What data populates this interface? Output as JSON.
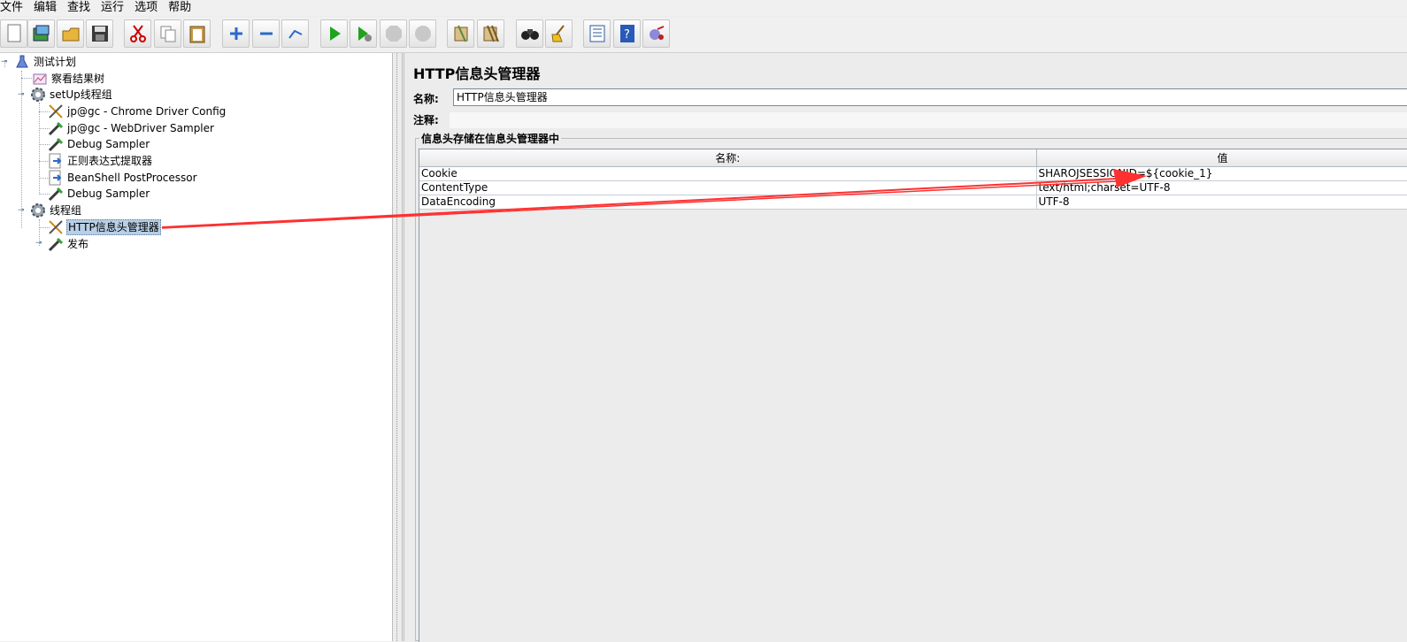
{
  "menu": [
    "文件",
    "编辑",
    "查找",
    "运行",
    "选项",
    "帮助"
  ],
  "toolbar": {
    "icons": [
      "new-icon",
      "templates-icon",
      "open-icon",
      "save-icon",
      "cut-icon",
      "copy-icon",
      "paste-icon",
      "expand-icon",
      "collapse-icon",
      "toggle-icon",
      "start-icon",
      "start-no-pause-icon",
      "stop-icon",
      "shutdown-icon",
      "clear-icon",
      "clear-all-icon",
      "search-icon",
      "reset-search-icon",
      "function-helper-icon",
      "help-icon",
      "remote-icon"
    ]
  },
  "tree": {
    "nodes": [
      {
        "label": "测试计划",
        "icon": "test-plan-icon"
      },
      {
        "label": "察看结果树",
        "icon": "listener-icon"
      },
      {
        "label": "setUp线程组",
        "icon": "thread-group-icon"
      },
      {
        "label": "jp@gc - Chrome Driver Config",
        "icon": "config-icon"
      },
      {
        "label": "jp@gc - WebDriver Sampler",
        "icon": "sampler-icon"
      },
      {
        "label": "Debug Sampler",
        "icon": "sampler-icon"
      },
      {
        "label": "正则表达式提取器",
        "icon": "postprocessor-icon"
      },
      {
        "label": "BeanShell PostProcessor",
        "icon": "postprocessor-icon"
      },
      {
        "label": "Debug Sampler",
        "icon": "sampler-icon"
      },
      {
        "label": "线程组",
        "icon": "thread-group-icon"
      },
      {
        "label": "HTTP信息头管理器",
        "icon": "config-icon"
      },
      {
        "label": "发布",
        "icon": "sampler-icon"
      }
    ]
  },
  "panel": {
    "title": "HTTP信息头管理器",
    "name_label": "名称:",
    "name_value": "HTTP信息头管理器",
    "comment_label": "注释:",
    "group_title": "信息头存储在信息头管理器中",
    "columns": [
      "名称:",
      "值"
    ],
    "rows": [
      {
        "name": "Cookie",
        "value": "SHAROJSESSIONID=${cookie_1}"
      },
      {
        "name": "ContentType",
        "value": "text/html;charset=UTF-8"
      },
      {
        "name": "DataEncoding",
        "value": "UTF-8"
      }
    ]
  },
  "colors": {
    "annotation_arrow": "#ff3030",
    "selection": "#b8cfe5"
  }
}
